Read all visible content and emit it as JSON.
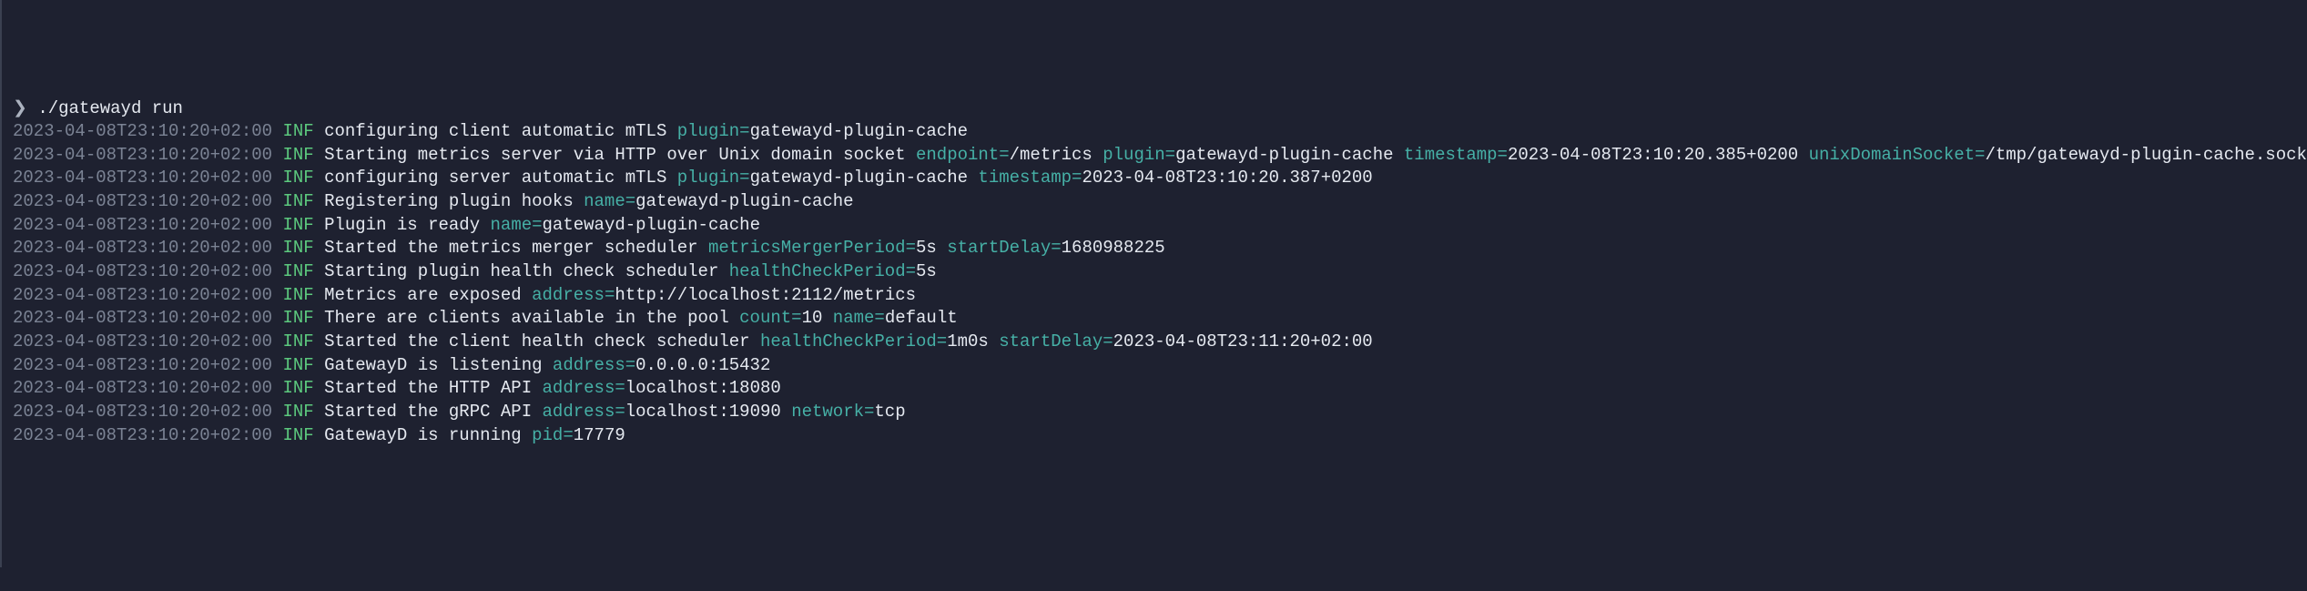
{
  "prompt": "❯",
  "command": "./gatewayd run",
  "ts": "2023-04-08T23:10:20+02:00",
  "level": "INF",
  "lines": {
    "l0": {
      "msg": "configuring client automatic mTLS ",
      "k0": "plugin=",
      "v0": "gatewayd-plugin-cache"
    },
    "l1": {
      "msg": "Starting metrics server via HTTP over Unix domain socket ",
      "k0": "endpoint=",
      "v0": "/metrics ",
      "k1": "plugin=",
      "v1": "gatewayd-plugin-cache ",
      "k2": "timestamp=",
      "v2": "2023-04-08T23:10:20.385+0200 ",
      "k3": "unixDomainSocket=",
      "v3": "/tmp/gatewayd-plugin-cache.sock"
    },
    "l2": {
      "msg": "configuring server automatic mTLS ",
      "k0": "plugin=",
      "v0": "gatewayd-plugin-cache ",
      "k1": "timestamp=",
      "v1": "2023-04-08T23:10:20.387+0200"
    },
    "l3": {
      "msg": "Registering plugin hooks ",
      "k0": "name=",
      "v0": "gatewayd-plugin-cache"
    },
    "l4": {
      "msg": "Plugin is ready ",
      "k0": "name=",
      "v0": "gatewayd-plugin-cache"
    },
    "l5": {
      "msg": "Started the metrics merger scheduler ",
      "k0": "metricsMergerPeriod=",
      "v0": "5s ",
      "k1": "startDelay=",
      "v1": "1680988225"
    },
    "l6": {
      "msg": "Starting plugin health check scheduler ",
      "k0": "healthCheckPeriod=",
      "v0": "5s"
    },
    "l7": {
      "msg": "Metrics are exposed ",
      "k0": "address=",
      "v0": "http://localhost:2112/metrics"
    },
    "l8": {
      "msg": "There are clients available in the pool ",
      "k0": "count=",
      "v0": "10 ",
      "k1": "name=",
      "v1": "default"
    },
    "l9": {
      "msg": "Started the client health check scheduler ",
      "k0": "healthCheckPeriod=",
      "v0": "1m0s ",
      "k1": "startDelay=",
      "v1": "2023-04-08T23:11:20+02:00"
    },
    "l10": {
      "msg": "GatewayD is listening ",
      "k0": "address=",
      "v0": "0.0.0.0:15432"
    },
    "l11": {
      "msg": "Started the HTTP API ",
      "k0": "address=",
      "v0": "localhost:18080"
    },
    "l12": {
      "msg": "Started the gRPC API ",
      "k0": "address=",
      "v0": "localhost:19090 ",
      "k1": "network=",
      "v1": "tcp"
    },
    "l13": {
      "msg": "GatewayD is running ",
      "k0": "pid=",
      "v0": "17779"
    }
  }
}
